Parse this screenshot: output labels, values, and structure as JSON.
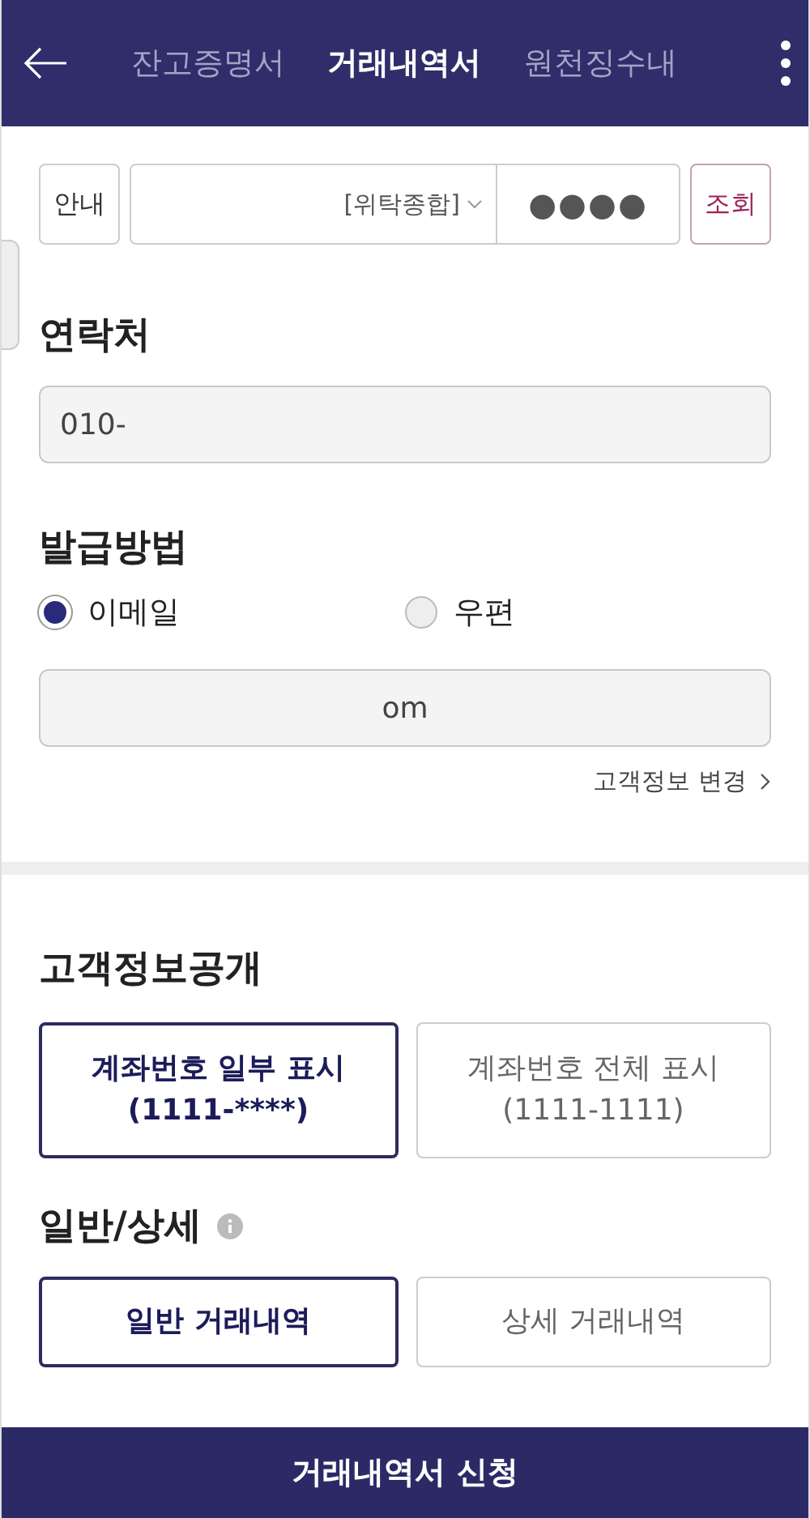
{
  "header": {
    "tabs": [
      {
        "label": "잔고증명서",
        "selected": false
      },
      {
        "label": "거래내역서",
        "selected": true
      },
      {
        "label": "원천징수내",
        "selected": false
      }
    ]
  },
  "account_row": {
    "guide_button": "안내",
    "account_select": "[위탁종합]",
    "password": "●●●●",
    "lookup_button": "조회"
  },
  "contact": {
    "label": "연락처",
    "value": "010-"
  },
  "delivery": {
    "label": "발급방법",
    "options": [
      {
        "label": "이메일",
        "selected": true
      },
      {
        "label": "우편",
        "selected": false
      }
    ],
    "email_value": "om",
    "change_link": "고객정보 변경"
  },
  "disclosure": {
    "label": "고객정보공개",
    "options": [
      {
        "line1": "계좌번호 일부 표시",
        "line2": "(1111-****)",
        "selected": true
      },
      {
        "line1": "계좌번호 전체 표시",
        "line2": "(1111-1111)",
        "selected": false
      }
    ]
  },
  "detail": {
    "label": "일반/상세",
    "options": [
      {
        "label": "일반 거래내역",
        "selected": true
      },
      {
        "label": "상세 거래내역",
        "selected": false
      }
    ]
  },
  "submit_button": "거래내역서 신청"
}
